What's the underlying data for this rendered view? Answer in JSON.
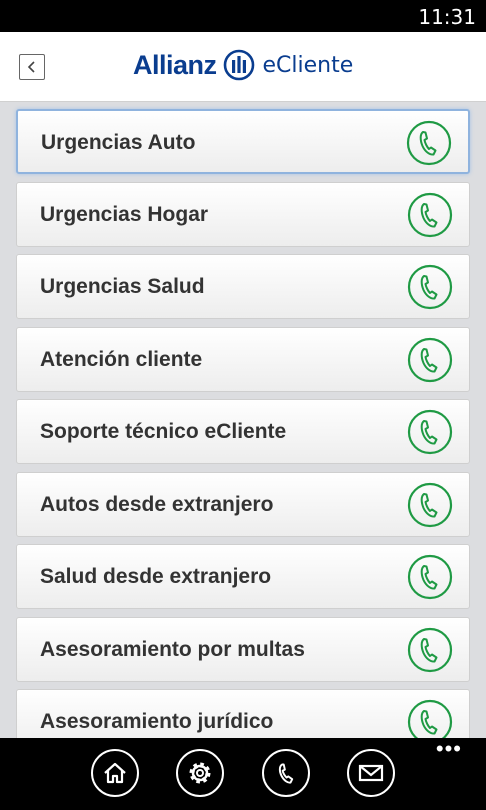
{
  "status": {
    "time": "11:31"
  },
  "header": {
    "brand": "Allianz",
    "app_name": "eCliente"
  },
  "list": {
    "items": [
      {
        "label": "Urgencias Auto"
      },
      {
        "label": "Urgencias Hogar"
      },
      {
        "label": "Urgencias Salud"
      },
      {
        "label": "Atención cliente"
      },
      {
        "label": "Soporte técnico eCliente"
      },
      {
        "label": "Autos desde extranjero"
      },
      {
        "label": "Salud desde extranjero"
      },
      {
        "label": "Asesoramiento por multas"
      },
      {
        "label": "Asesoramiento jurídico"
      }
    ],
    "selected_index": 0
  },
  "app_bar": {
    "buttons": [
      "home-icon",
      "gear-icon",
      "phone-icon",
      "mail-icon"
    ],
    "more": "•••"
  },
  "colors": {
    "brand_blue": "#0a3d8f",
    "call_green": "#1f9a44"
  }
}
